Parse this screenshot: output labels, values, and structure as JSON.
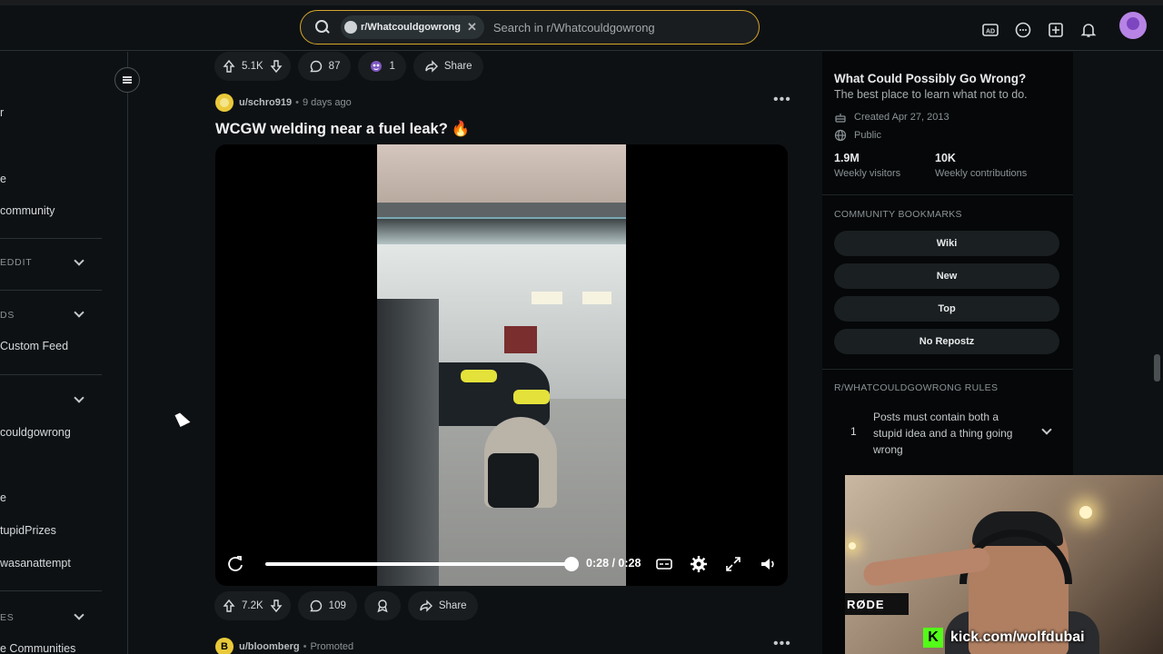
{
  "header": {
    "search_chip": "r/Whatcouldgowrong",
    "search_placeholder": "Search in r/Whatcouldgowrong"
  },
  "sidebar": {
    "items": [
      {
        "label": "r"
      },
      {
        "label": "e"
      },
      {
        "label": "community"
      },
      {
        "label": " Custom Feed"
      },
      {
        "label": "couldgowrong"
      },
      {
        "label": "e"
      },
      {
        "label": "tupidPrizes"
      },
      {
        "label": "wasanattempt"
      },
      {
        "label": "e Communities"
      }
    ],
    "sections": [
      "EDDIT",
      "DS",
      "ES"
    ]
  },
  "feed": {
    "prev_post_actions": {
      "votes": "5.1K",
      "comments": "87",
      "awards": "1",
      "share": "Share"
    },
    "post": {
      "author": "u/schro919",
      "time": "9 days ago",
      "title": "WCGW welding near a fuel leak?",
      "video_time": "0:28 / 0:28",
      "progress": 1.0,
      "votes": "7.2K",
      "comments": "109",
      "share": "Share"
    },
    "next_post": {
      "author": "u/bloomberg",
      "label": "Promoted"
    }
  },
  "community": {
    "name": "What Could Possibly Go Wrong?",
    "description": "The best place to learn what not to do.",
    "created": "Created Apr 27, 2013",
    "visibility": "Public",
    "visitors": "1.9M",
    "visitors_label": "Weekly visitors",
    "contributions": "10K",
    "contributions_label": "Weekly contributions",
    "bookmarks_title": "COMMUNITY BOOKMARKS",
    "bookmarks": [
      "Wiki",
      "New",
      "Top",
      "No Repostz"
    ],
    "rules_title": "R/WHATCOULDGOWRONG RULES",
    "rule_number": "1",
    "rule_text": "Posts must contain both a stupid idea and a thing going wrong"
  },
  "overlay": {
    "mic_brand": "RØDE",
    "kick_logo": "K",
    "kick_url": "kick.com/wolfdubai"
  },
  "colors": {
    "background": "#0e1113",
    "search_border": "#d4a72c",
    "kick_green": "#53fc18"
  }
}
